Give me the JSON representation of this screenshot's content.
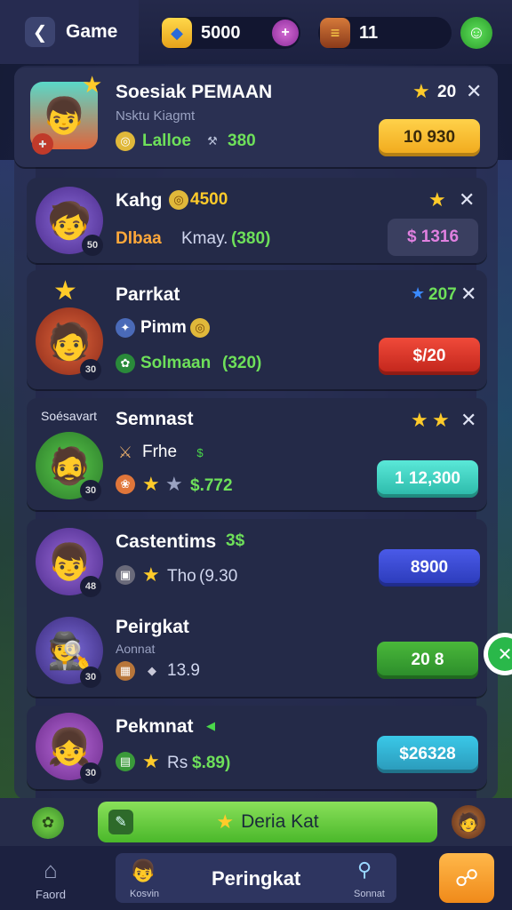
{
  "header": {
    "back_icon": "back-arrow-icon",
    "title": "Game",
    "gems": "5000",
    "coins": "11",
    "colors": {
      "gem": "#ffd84a",
      "plus": "#c04ac0",
      "smile": "#4ad04a"
    }
  },
  "cards": [
    {
      "name": "Soesiak PEMAAN",
      "sub": "Nsktu Kiagmt",
      "stat_label": "Lalloe",
      "stat_value": "380",
      "stars": "20",
      "button": "10 930",
      "button_color": "#ffc02a"
    },
    {
      "name": "Kahg",
      "name_extra": "4500",
      "stat_label": "Dlbaa",
      "stat_mid": "Kmay.",
      "stat_value": "(380)",
      "button": "$ 1316",
      "button_color": "#3a3f60"
    },
    {
      "name": "Parrkat",
      "stat_label": "Pimm",
      "stat_label2": "Solmaan",
      "stat_value": "(320)",
      "right_stat": "207",
      "button": "$/20",
      "button_color": "#e0342a"
    },
    {
      "name": "Semnast",
      "tag": "Soésavart",
      "stat_label": "Frhe",
      "stat_value": "$.772",
      "button": "1 12,300",
      "button_color": "#3ad8c8"
    },
    {
      "name": "Castentims",
      "name_extra": "3$",
      "stat_label": "Tho",
      "stat_value": "(9.30",
      "button": "8900",
      "button_color": "#3a4ad8"
    },
    {
      "name": "Peirgkat",
      "sub": "Aonnat",
      "stat_value": "13.9",
      "button": "20 8",
      "button_color": "#3aa82a"
    },
    {
      "name": "Pekmnat",
      "stat_label": "Rs",
      "stat_value": "$.89)",
      "button": "$26328",
      "button_color": "#2aa8c8"
    }
  ],
  "actionbar": {
    "label": "Deria Kat"
  },
  "bottom_nav": {
    "home": "Faord",
    "center_sub": "Kosvin",
    "center_title": "Peringkat",
    "search_sub": "Sonnat"
  }
}
